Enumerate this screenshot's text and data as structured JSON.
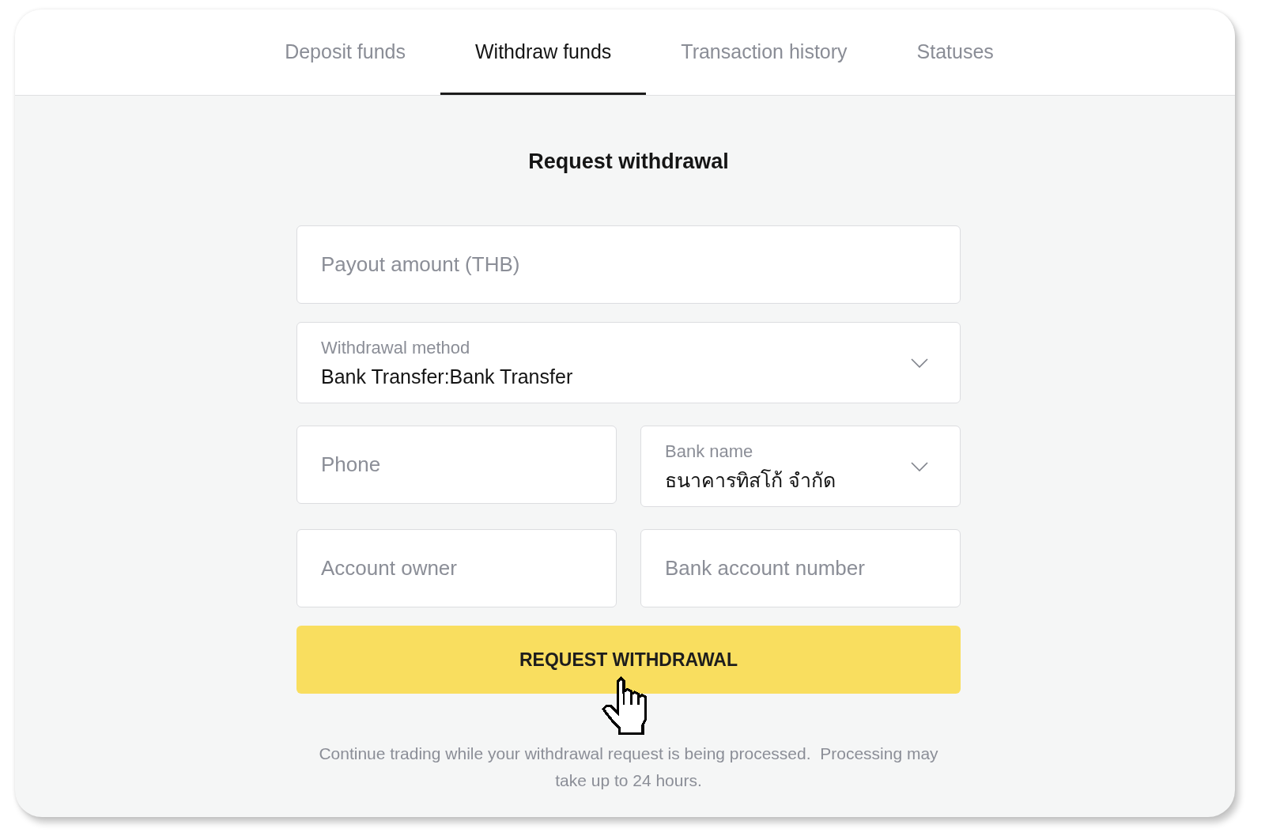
{
  "tabs": [
    {
      "label": "Deposit funds",
      "selected": false
    },
    {
      "label": "Withdraw funds",
      "selected": true
    },
    {
      "label": "Transaction history",
      "selected": false
    },
    {
      "label": "Statuses",
      "selected": false
    }
  ],
  "form": {
    "title": "Request withdrawal",
    "rows": [
      {
        "fields": [
          {
            "kind": "input",
            "placeholder": "Payout amount (THB)"
          }
        ]
      },
      {
        "fields": [
          {
            "kind": "select",
            "label": "Withdrawal method",
            "value": "Bank Transfer:Bank Transfer"
          }
        ]
      },
      {
        "fields": [
          {
            "kind": "input",
            "placeholder": "Phone"
          },
          {
            "kind": "select",
            "label": "Bank name",
            "value": "ธนาคารทิสโก้ จำกัด"
          }
        ]
      },
      {
        "fields": [
          {
            "kind": "input",
            "placeholder": "Account owner"
          },
          {
            "kind": "input",
            "placeholder": "Bank account number"
          }
        ]
      }
    ],
    "submit_button": "REQUEST WITHDRAWAL",
    "note": "Continue trading while your withdrawal request is being processed.  Processing may take up to 24 hours."
  }
}
